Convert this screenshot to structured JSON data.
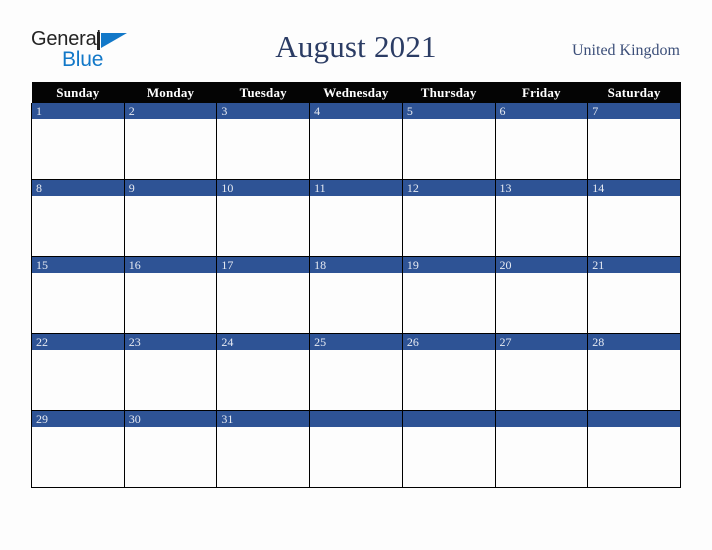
{
  "logo": {
    "word_one": "General",
    "word_two": "Blue",
    "mark": "triangle-logo-mark",
    "color_primary": "#1278c8",
    "color_text": "#232323"
  },
  "header": {
    "title": "August 2021",
    "country": "United Kingdom",
    "title_color": "#2b3c64",
    "country_color": "#3c4f79"
  },
  "calendar": {
    "weekdays": [
      "Sunday",
      "Monday",
      "Tuesday",
      "Wednesday",
      "Thursday",
      "Friday",
      "Saturday"
    ],
    "header_bg": "#040404",
    "header_fg": "#ffffff",
    "daynum_bg": "#2e5395",
    "daynum_fg": "#e6eaf2",
    "cell_bg": "#fdfdfd",
    "border_color": "#000000",
    "weeks": [
      [
        {
          "day": "1",
          "events": ""
        },
        {
          "day": "2",
          "events": ""
        },
        {
          "day": "3",
          "events": ""
        },
        {
          "day": "4",
          "events": ""
        },
        {
          "day": "5",
          "events": ""
        },
        {
          "day": "6",
          "events": ""
        },
        {
          "day": "7",
          "events": ""
        }
      ],
      [
        {
          "day": "8",
          "events": ""
        },
        {
          "day": "9",
          "events": ""
        },
        {
          "day": "10",
          "events": ""
        },
        {
          "day": "11",
          "events": ""
        },
        {
          "day": "12",
          "events": ""
        },
        {
          "day": "13",
          "events": ""
        },
        {
          "day": "14",
          "events": ""
        }
      ],
      [
        {
          "day": "15",
          "events": ""
        },
        {
          "day": "16",
          "events": ""
        },
        {
          "day": "17",
          "events": ""
        },
        {
          "day": "18",
          "events": ""
        },
        {
          "day": "19",
          "events": ""
        },
        {
          "day": "20",
          "events": ""
        },
        {
          "day": "21",
          "events": ""
        }
      ],
      [
        {
          "day": "22",
          "events": ""
        },
        {
          "day": "23",
          "events": ""
        },
        {
          "day": "24",
          "events": ""
        },
        {
          "day": "25",
          "events": ""
        },
        {
          "day": "26",
          "events": ""
        },
        {
          "day": "27",
          "events": ""
        },
        {
          "day": "28",
          "events": ""
        }
      ],
      [
        {
          "day": "29",
          "events": ""
        },
        {
          "day": "30",
          "events": ""
        },
        {
          "day": "31",
          "events": ""
        },
        {
          "day": "",
          "events": ""
        },
        {
          "day": "",
          "events": ""
        },
        {
          "day": "",
          "events": ""
        },
        {
          "day": "",
          "events": ""
        }
      ]
    ]
  }
}
